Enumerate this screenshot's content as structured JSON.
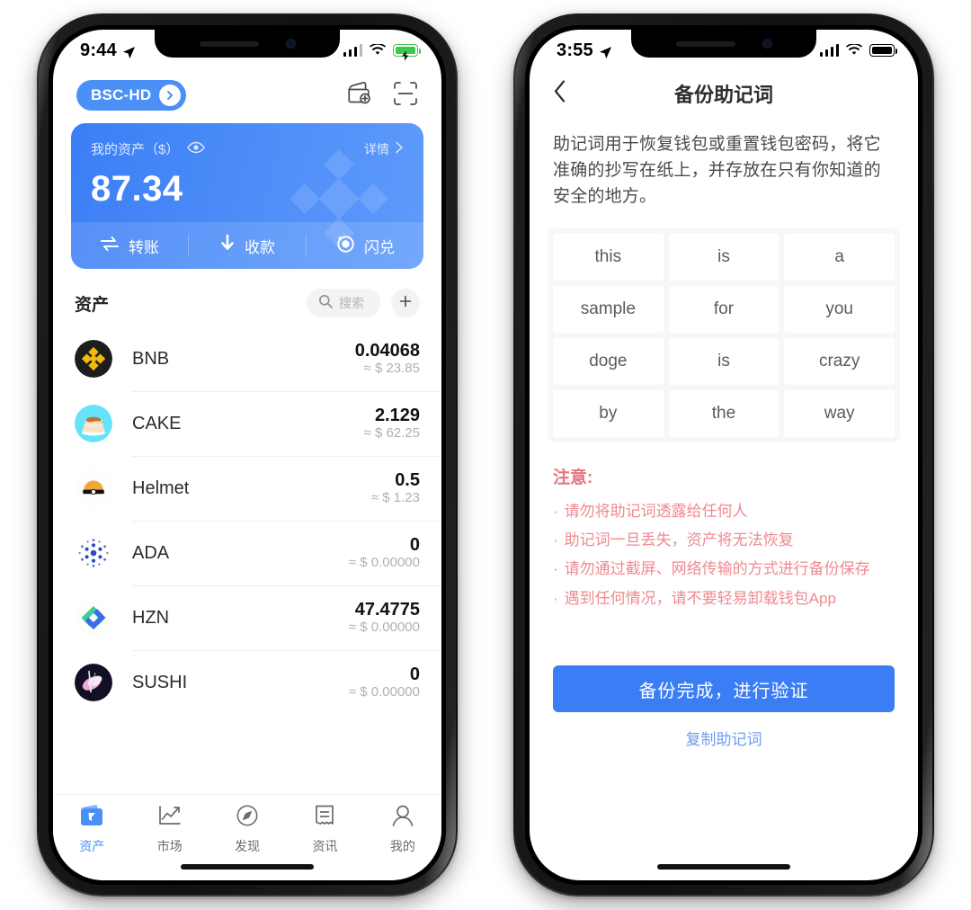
{
  "phone1": {
    "status": {
      "time": "9:44",
      "location_icon": "location-arrow-icon",
      "signal": "signal-bars-icon",
      "wifi": "wifi-icon",
      "battery": "battery-charging-icon"
    },
    "header": {
      "wallet_label": "BSC-HD",
      "chevron_icon": "chevron-right-icon",
      "wallet_add_icon": "wallet-add-icon",
      "scan_icon": "scan-qr-icon"
    },
    "balance_card": {
      "title": "我的资产（$）",
      "eye_icon": "eye-icon",
      "detail_label": "详情",
      "detail_chevron_icon": "chevron-right-icon",
      "amount": "87.34",
      "watermark_icon": "binance-logo-watermark",
      "actions": [
        {
          "label": "转账",
          "icon": "transfer-icon"
        },
        {
          "label": "收款",
          "icon": "receive-arrow-down-icon"
        },
        {
          "label": "闪兑",
          "icon": "swap-flash-icon"
        }
      ],
      "bg_color": "#4a8bf8"
    },
    "assets": {
      "section_title": "资产",
      "search_placeholder": "搜索",
      "search_icon": "search-icon",
      "add_icon": "plus-icon",
      "items": [
        {
          "symbol": "BNB",
          "amount": "0.04068",
          "fiat": "≈ $ 23.85",
          "icon": "bnb-coin-icon"
        },
        {
          "symbol": "CAKE",
          "amount": "2.129",
          "fiat": "≈ $ 62.25",
          "icon": "cake-coin-icon"
        },
        {
          "symbol": "Helmet",
          "amount": "0.5",
          "fiat": "≈ $ 1.23",
          "icon": "helmet-coin-icon"
        },
        {
          "symbol": "ADA",
          "amount": "0",
          "fiat": "≈ $ 0.00000",
          "icon": "ada-coin-icon"
        },
        {
          "symbol": "HZN",
          "amount": "47.4775",
          "fiat": "≈ $ 0.00000",
          "icon": "hzn-coin-icon"
        },
        {
          "symbol": "SUSHI",
          "amount": "0",
          "fiat": "≈ $ 0.00000",
          "icon": "sushi-coin-icon"
        }
      ]
    },
    "tabbar": {
      "active_color": "#4a90f7",
      "items": [
        {
          "label": "资产",
          "icon": "wallet-icon",
          "active": true
        },
        {
          "label": "市场",
          "icon": "chart-line-icon",
          "active": false
        },
        {
          "label": "发现",
          "icon": "compass-icon",
          "active": false
        },
        {
          "label": "资讯",
          "icon": "news-icon",
          "active": false
        },
        {
          "label": "我的",
          "icon": "person-icon",
          "active": false
        }
      ]
    }
  },
  "phone2": {
    "status": {
      "time": "3:55",
      "location_icon": "location-arrow-icon",
      "signal": "signal-bars-icon",
      "wifi": "wifi-icon",
      "battery": "battery-full-icon"
    },
    "nav": {
      "back_icon": "chevron-left-icon",
      "title": "备份助记词"
    },
    "description": "助记词用于恢复钱包或重置钱包密码，将它准确的抄写在纸上，并存放在只有你知道的安全的地方。",
    "mnemonic": [
      "this",
      "is",
      "a",
      "sample",
      "for",
      "you",
      "doge",
      "is",
      "crazy",
      "by",
      "the",
      "way"
    ],
    "notice": {
      "title": "注意:",
      "items": [
        "请勿将助记词透露给任何人",
        "助记词一旦丢失，资产将无法恢复",
        "请勿通过截屏、网络传输的方式进行备份保存",
        "遇到任何情况，请不要轻易卸载钱包App"
      ],
      "color": "#ef8a90"
    },
    "footer": {
      "primary_label": "备份完成，进行验证",
      "primary_color": "#3b7df5",
      "secondary_label": "复制助记词"
    }
  }
}
